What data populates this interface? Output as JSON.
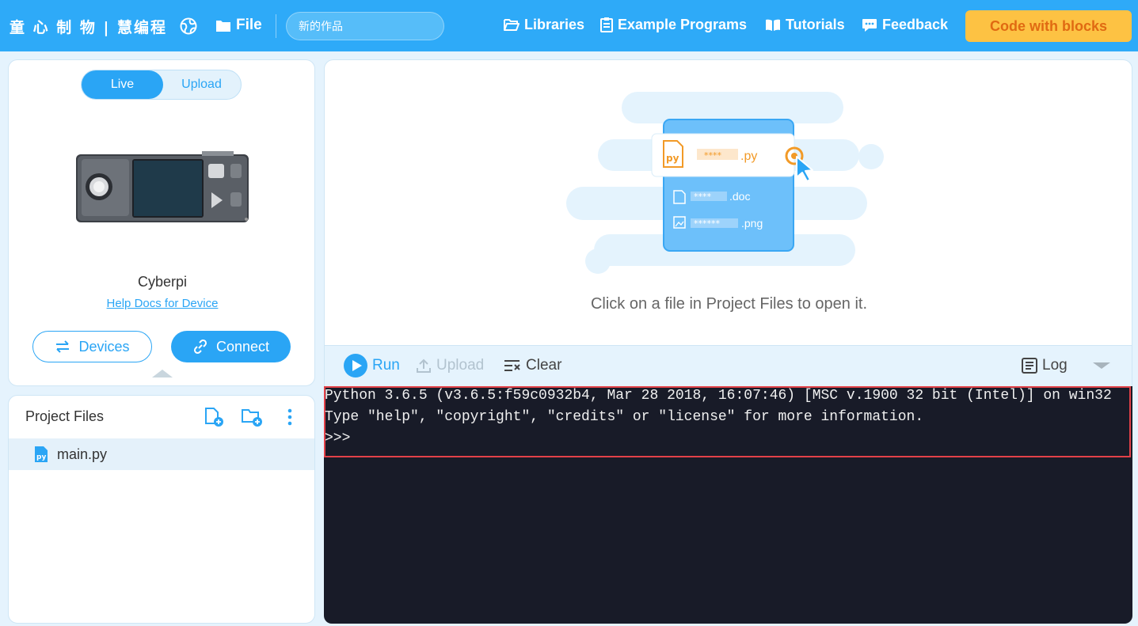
{
  "topbar": {
    "brand": "童 心 制 物 | 慧编程",
    "file_label": "File",
    "project_name": "新的作品",
    "nav": {
      "libraries": "Libraries",
      "examples": "Example Programs",
      "tutorials": "Tutorials",
      "feedback": "Feedback"
    },
    "code_with_blocks": "Code with blocks"
  },
  "device": {
    "mode_live": "Live",
    "mode_upload": "Upload",
    "active_mode": "Live",
    "name": "Cyberpi",
    "help_link": "Help Docs for Device",
    "devices_button": "Devices",
    "connect_button": "Connect"
  },
  "files": {
    "title": "Project Files",
    "items": [
      {
        "name": "main.py",
        "icon": "python-file-icon",
        "selected": true
      }
    ]
  },
  "editor": {
    "hint": "Click on a file in Project Files to open it.",
    "illustration": {
      "py_label": "****",
      "py_ext": ".py",
      "doc_label": "****",
      "doc_ext": ".doc",
      "png_label": "******",
      "png_ext": ".png"
    }
  },
  "console_toolbar": {
    "run": "Run",
    "upload": "Upload",
    "clear": "Clear",
    "log": "Log"
  },
  "console": {
    "lines": [
      "Python 3.6.5 (v3.6.5:f59c0932b4, Mar 28 2018, 16:07:46) [MSC v.1900 32 bit (Intel)] on win32",
      "Type \"help\", \"copyright\", \"credits\" or \"license\" for more information.",
      ">>>"
    ]
  },
  "colors": {
    "topbar": "#2eaaf8",
    "accent": "#2aa5f5",
    "cta_bg": "#fdc243",
    "cta_text": "#e06a12",
    "console_bg": "#181b28",
    "highlight_border": "#e24148"
  }
}
